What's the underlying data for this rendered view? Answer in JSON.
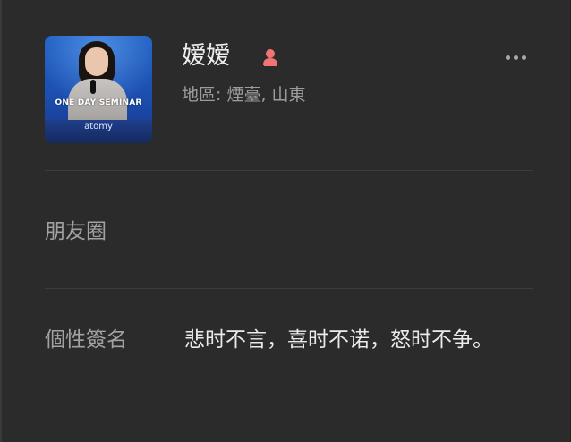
{
  "profile": {
    "name": "嫒嫒",
    "gender": "female",
    "gender_icon": "female-icon",
    "gender_color": "#f07474",
    "region": "地區: 煙臺, 山東",
    "avatar": {
      "banner_text": "ONE DAY SEMINAR",
      "brand_text": "atomy"
    }
  },
  "header": {
    "more_icon": "more-horizontal-icon"
  },
  "rows": {
    "moments_label": "朋友圈",
    "signature_label": "個性簽名",
    "signature_value": "悲时不言，喜时不诺，怒时不争。"
  },
  "colors": {
    "background": "#2b2b2b",
    "divider": "#3d3d3d",
    "label": "#a2a2a2",
    "text": "#eaeaea"
  }
}
